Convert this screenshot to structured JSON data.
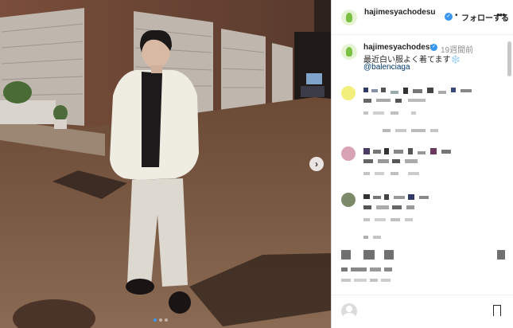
{
  "header": {
    "username": "hajimesyachodesu",
    "separator": "•",
    "follow_label": "フォローする",
    "more_icon": "more-horizontal-icon"
  },
  "caption": {
    "username": "hajimesyachodesu",
    "time": "19週間前",
    "text": "最近白い服よく着てます❄️",
    "tag": "@balenciaga"
  },
  "carousel": {
    "next_icon": "chevron-right-icon",
    "slide_count": 3,
    "active_slide": 1
  },
  "colors": {
    "accent": "#3897f0",
    "link": "#00376b"
  }
}
